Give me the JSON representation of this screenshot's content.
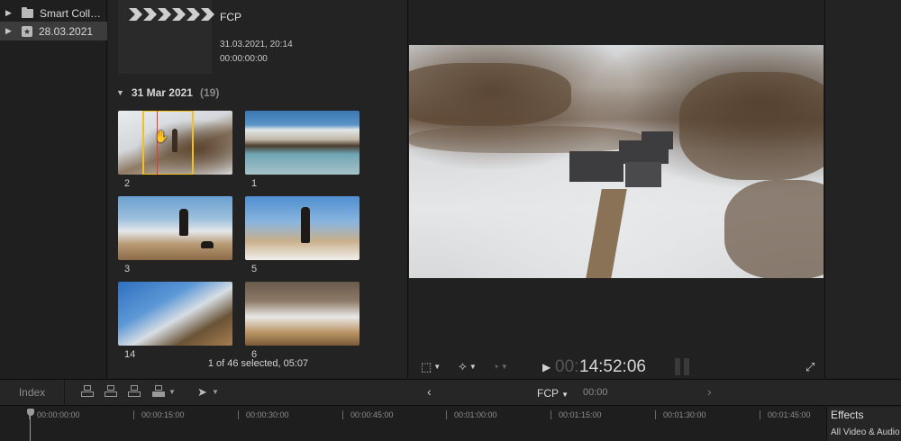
{
  "sidebar": {
    "items": [
      {
        "label": "Smart Coll…",
        "icon": "folder-icon",
        "selected": false
      },
      {
        "label": "28.03.2021",
        "icon": "library-star-icon",
        "selected": true
      }
    ]
  },
  "browser": {
    "event": {
      "title": "FCP",
      "date": "31.03.2021, 20:14",
      "duration": "00:00:00:00"
    },
    "date_group": {
      "label": "31 Mar 2021",
      "count": "(19)"
    },
    "clips": [
      {
        "label": "2"
      },
      {
        "label": "1"
      },
      {
        "label": "3"
      },
      {
        "label": "5"
      },
      {
        "label": "14"
      },
      {
        "label": "6"
      }
    ],
    "status": "1 of 46 selected, 05:07"
  },
  "viewer": {
    "timecode_dim": "00:",
    "timecode": "14:52:06"
  },
  "timeline_toolbar": {
    "index_label": "Index",
    "project_name": "FCP",
    "timecode": "00:00"
  },
  "ruler": {
    "labels": [
      "00:00:00:00",
      "00:00:15:00",
      "00:00:30:00",
      "00:00:45:00",
      "00:01:00:00",
      "00:01:15:00",
      "00:01:30:00",
      "00:01:45:00"
    ]
  },
  "effects": {
    "title": "Effects",
    "subtitle": "All Video & Audio"
  },
  "colors": {
    "skimmer_yellow": "#f2c21c",
    "playhead_red": "#e23b2e",
    "selected_row": "#3c3c3c"
  }
}
